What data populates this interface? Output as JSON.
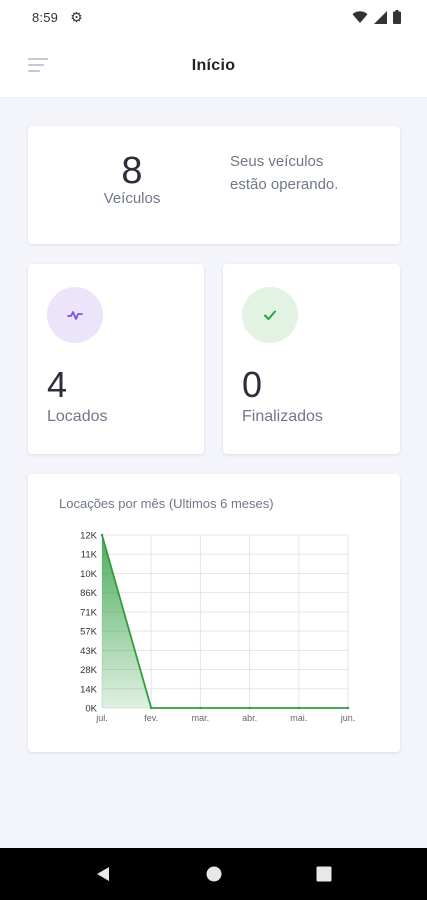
{
  "status_bar": {
    "time": "8:59",
    "icons": [
      "gear-icon",
      "wifi-icon",
      "signal-icon",
      "battery-icon"
    ]
  },
  "app_bar": {
    "title": "Início",
    "menu_icon": "hamburger-menu-icon"
  },
  "vehicles_card": {
    "count": "8",
    "label": "Veículos",
    "status_text": "Seus veículos estão operando."
  },
  "rented_card": {
    "icon": "activity-icon",
    "icon_bg": "#ebe4fb",
    "icon_color": "#7b52e6",
    "count": "4",
    "label": "Locados"
  },
  "finished_card": {
    "icon": "check-icon",
    "icon_bg": "#e2f3e4",
    "icon_color": "#2f9e44",
    "count": "0",
    "label": "Finalizados"
  },
  "chart_data": {
    "type": "area",
    "title": "Locações por mês (Ultimos 6 meses)",
    "categories": [
      "jul.",
      "fev.",
      "mar.",
      "abr.",
      "mai.",
      "jun."
    ],
    "y_tick_labels": [
      "0K",
      "14K",
      "28K",
      "43K",
      "57K",
      "71K",
      "86K",
      "10K",
      "11K",
      "12K"
    ],
    "values": [
      12,
      0,
      0,
      0,
      0,
      0
    ],
    "ylim": [
      0,
      12
    ],
    "grid": true,
    "color": "#2e9e3e"
  },
  "nav_bar": {
    "buttons": [
      "back-button",
      "home-button",
      "recents-button"
    ]
  }
}
